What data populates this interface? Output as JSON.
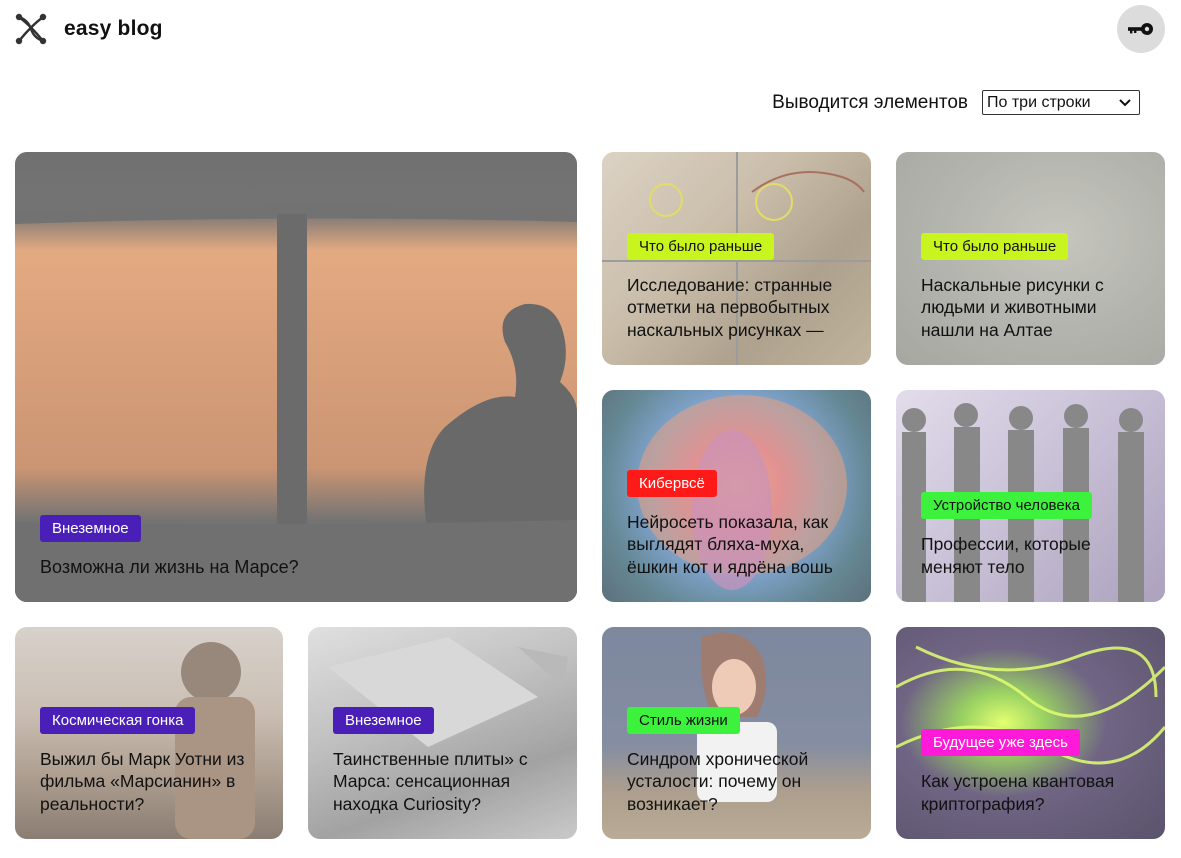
{
  "header": {
    "brand": "easy blog",
    "logo_icon": "network-logo-icon",
    "login_icon": "key-icon"
  },
  "controls": {
    "label": "Выводится элементов",
    "select_value": "По три строки"
  },
  "cards": [
    {
      "tag": "Внеземное",
      "tag_bg": "#4a1fb8",
      "tag_color": "#ffffff",
      "title": "Возможна ли жизнь на Марсе?"
    },
    {
      "tag": "Что было раньше",
      "tag_bg": "#c8f51e",
      "tag_color": "#111111",
      "title": "Исследование: странные отметки на первобытных наскальных рисунках —"
    },
    {
      "tag": "Что было раньше",
      "tag_bg": "#c8f51e",
      "tag_color": "#111111",
      "title": "Наскальные рисунки с людьми и животными нашли на Алтае"
    },
    {
      "tag": "Кибервсё",
      "tag_bg": "#ff1a1a",
      "tag_color": "#ffffff",
      "title": "Нейросеть показала, как выглядят бляха-муха, ёшкин кот и ядрёна вошь"
    },
    {
      "tag": "Устройство человека",
      "tag_bg": "#3df23d",
      "tag_color": "#111111",
      "title": "Профессии, которые меняют тело"
    },
    {
      "tag": "Космическая гонка",
      "tag_bg": "#4a1fb8",
      "tag_color": "#ffffff",
      "title": "Выжил бы Марк Уотни из фильма «Марсианин» в реальности?"
    },
    {
      "tag": "Внеземное",
      "tag_bg": "#4a1fb8",
      "tag_color": "#ffffff",
      "title": "Таинственные плиты» с Марса: сенсационная находка Curiosity?"
    },
    {
      "tag": "Стиль жизни",
      "tag_bg": "#3df23d",
      "tag_color": "#111111",
      "title": "Синдром хронической усталости: почему он возникает?"
    },
    {
      "tag": "Будущее уже здесь",
      "tag_bg": "#ff1ad9",
      "tag_color": "#ffffff",
      "title": "Как устроена квантовая криптография?"
    }
  ]
}
